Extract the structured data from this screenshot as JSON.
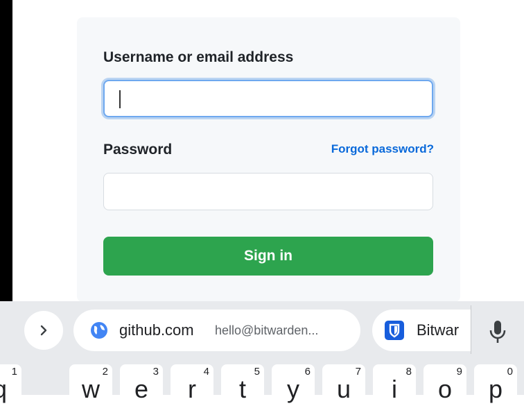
{
  "login": {
    "username_label": "Username or email address",
    "password_label": "Password",
    "forgot_link": "Forgot password?",
    "username_value": "",
    "password_value": "",
    "sign_in_label": "Sign in",
    "colors": {
      "primary_button": "#2da44e",
      "link": "#0969da",
      "focus": "#6ea8ef"
    }
  },
  "keyboard": {
    "expand_icon": "chevron-right-icon",
    "suggestions": [
      {
        "domain": "github.com",
        "user": "hello@bitwarden...",
        "icon": "globe-icon"
      },
      {
        "name": "Bitwar",
        "icon": "bitwarden-shield-icon"
      }
    ],
    "mic_icon": "microphone-icon",
    "keys": [
      {
        "letter": "q",
        "num": "1"
      },
      {
        "letter": "w",
        "num": "2"
      },
      {
        "letter": "e",
        "num": "3"
      },
      {
        "letter": "r",
        "num": "4"
      },
      {
        "letter": "t",
        "num": "5"
      },
      {
        "letter": "y",
        "num": "6"
      },
      {
        "letter": "u",
        "num": "7"
      },
      {
        "letter": "i",
        "num": "8"
      },
      {
        "letter": "o",
        "num": "9"
      },
      {
        "letter": "p",
        "num": "0"
      }
    ]
  }
}
